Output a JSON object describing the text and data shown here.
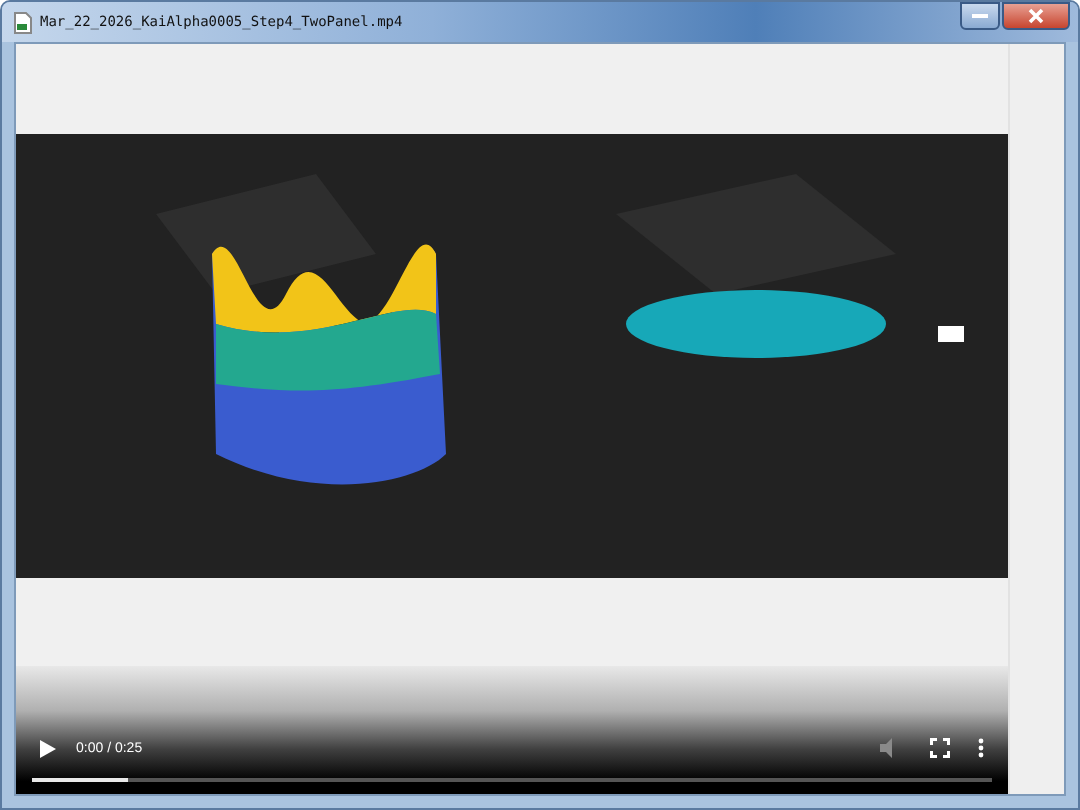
{
  "window": {
    "title": "Mar_22_2026_KaiAlpha0005_Step4_TwoPanel.mp4"
  },
  "video": {
    "time": "0:00 / 0:25",
    "progress": {
      "level": 0.1
    },
    "muted": true
  }
}
